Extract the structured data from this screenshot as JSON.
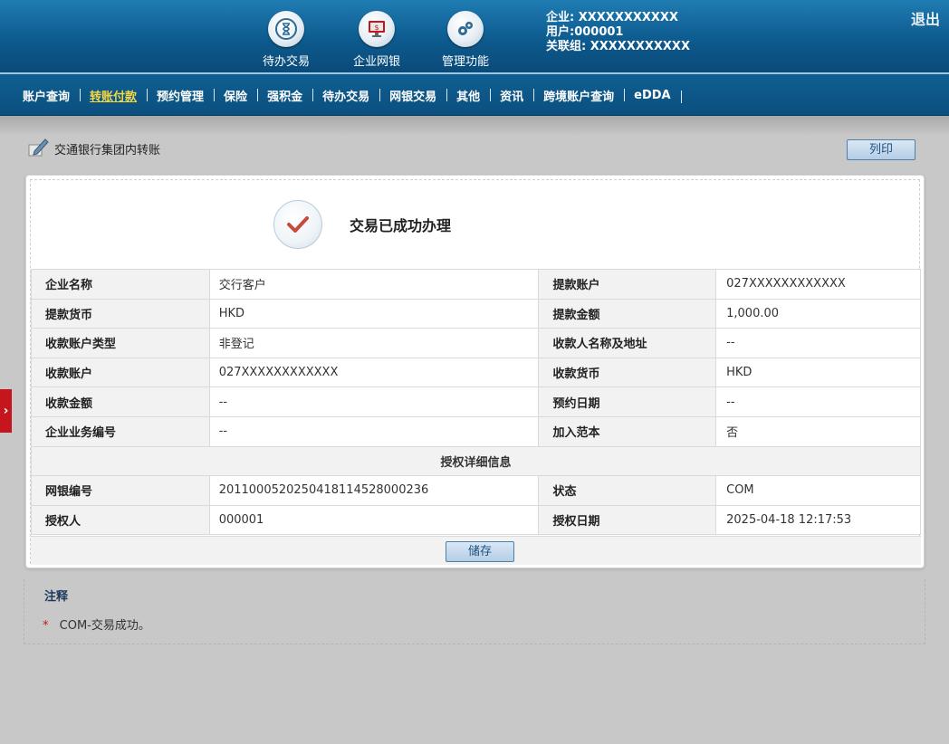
{
  "header": {
    "tools": [
      {
        "icon": "hourglass-icon",
        "label": "待办交易"
      },
      {
        "icon": "monitor-icon",
        "label": "企业网银"
      },
      {
        "icon": "gears-icon",
        "label": "管理功能"
      }
    ],
    "user": {
      "company": "企业: XXXXXXXXXXX",
      "user": "用户:000001",
      "linked": "关联组: XXXXXXXXXXX"
    },
    "logout_label": "退出"
  },
  "nav": {
    "items": [
      "账户查询",
      "转账付款",
      "预约管理",
      "保险",
      "强积金",
      "待办交易",
      "网银交易",
      "其他",
      "资讯",
      "跨境账户查询",
      "eDDA"
    ],
    "active_index": 1
  },
  "page": {
    "title": "交通银行集团内转账",
    "print_label": "列印",
    "side_tab": "›"
  },
  "result": {
    "message": "交易已成功办理",
    "rows": [
      {
        "k1": "企业名称",
        "v1": "交行客户",
        "k2": "提款账户",
        "v2": "027XXXXXXXXXXXX"
      },
      {
        "k1": "提款货币",
        "v1": "HKD",
        "k2": "提款金额",
        "v2": "1,000.00"
      },
      {
        "k1": "收款账户类型",
        "v1": "非登记",
        "k2": "收款人名称及地址",
        "v2": "--"
      },
      {
        "k1": "收款账户",
        "v1": "027XXXXXXXXXXXX",
        "k2": "收款货币",
        "v2": "HKD"
      },
      {
        "k1": "收款金额",
        "v1": "--",
        "k2": "预约日期",
        "v2": "--"
      },
      {
        "k1": "企业业务编号",
        "v1": "--",
        "k2": "加入范本",
        "v2": "否"
      }
    ],
    "auth_section_title": "授权详细信息",
    "auth_rows": [
      {
        "k1": "网银编号",
        "v1": "201100052025041811452800023​6",
        "k2": "状态",
        "v2": "COM"
      },
      {
        "k1": "授权人",
        "v1": "000001",
        "k2": "授权日期",
        "v2": "2025-04-18 12:17:53"
      }
    ],
    "save_label": "储存"
  },
  "notes": {
    "title": "注释",
    "items": [
      "COM-交易成功。"
    ],
    "bullet": "*"
  },
  "colors": {
    "header_blue": "#0d5a8e",
    "active_nav": "#f5d742",
    "check_red": "#c94a3b"
  }
}
